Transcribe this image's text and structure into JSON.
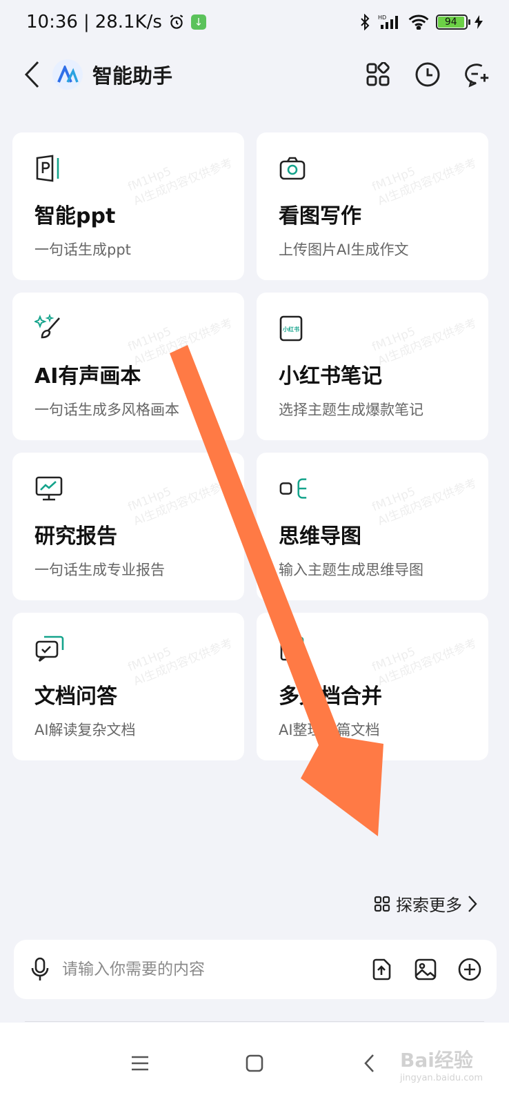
{
  "statusbar": {
    "time": "10:36",
    "speed": "28.1K/s",
    "battery_level": "94",
    "battery_fraction": 0.94,
    "network_label": "HD"
  },
  "header": {
    "title": "智能助手"
  },
  "cards": [
    {
      "title": "智能ppt",
      "subtitle": "一句话生成ppt",
      "icon": "ppt-icon"
    },
    {
      "title": "看图写作",
      "subtitle": "上传图片AI生成作文",
      "icon": "camera-icon"
    },
    {
      "title": "AI有声画本",
      "subtitle": "一句话生成多风格画本",
      "icon": "paintbrush-sparkle-icon"
    },
    {
      "title": "小红书笔记",
      "subtitle": "选择主题生成爆款笔记",
      "icon": "xiaohongshu-icon",
      "icon_text": "小红书"
    },
    {
      "title": "研究报告",
      "subtitle": "一句话生成专业报告",
      "icon": "monitor-chart-icon"
    },
    {
      "title": "思维导图",
      "subtitle": "输入主题生成思维导图",
      "icon": "mindmap-icon"
    },
    {
      "title": "文档问答",
      "subtitle": "AI解读复杂文档",
      "icon": "chat-doc-icon"
    },
    {
      "title": "多文档合并",
      "subtitle": "AI整理多篇文档",
      "icon": "merge-doc-icon"
    }
  ],
  "watermark": {
    "line1": "fM1Hp5",
    "line2": "AI生成内容仅供参考"
  },
  "explore": {
    "label": "探索更多"
  },
  "input": {
    "placeholder": "请输入你需要的内容"
  },
  "baidu": {
    "brand": "Bai经验",
    "url": "jingyan.baidu.com"
  },
  "colors": {
    "accent_green": "#14a38b",
    "arrow_orange": "#ff7a45",
    "background": "#f2f3f8"
  }
}
